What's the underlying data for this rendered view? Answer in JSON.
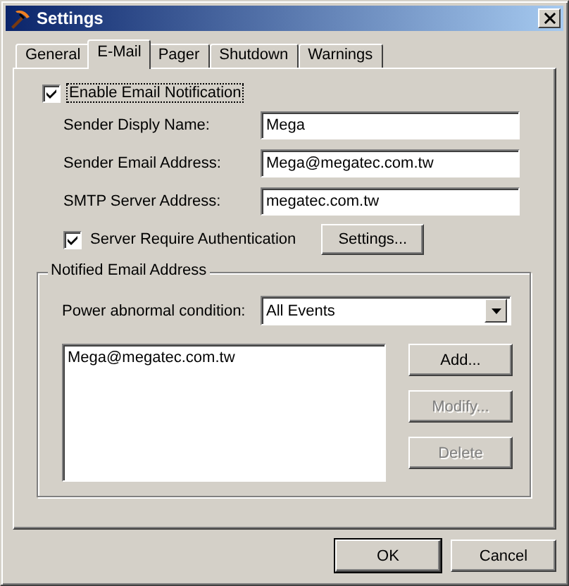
{
  "window": {
    "title": "Settings"
  },
  "tabs": [
    {
      "label": "General",
      "selected": false
    },
    {
      "label": "E-Mail",
      "selected": true
    },
    {
      "label": "Pager",
      "selected": false
    },
    {
      "label": "Shutdown",
      "selected": false
    },
    {
      "label": "Warnings",
      "selected": false
    }
  ],
  "enable_notification": {
    "label": "Enable Email Notification",
    "checked": true,
    "focused": true
  },
  "fields": [
    {
      "label": "Sender Disply Name:",
      "value": "Mega"
    },
    {
      "label": "Sender Email Address:",
      "value": "Mega@megatec.com.tw"
    },
    {
      "label": "SMTP Server Address:",
      "value": "megatec.com.tw"
    }
  ],
  "authentication": {
    "label": "Server Require Authentication",
    "checked": true
  },
  "settings_button": {
    "label": "Settings..."
  },
  "notified_group": {
    "title": "Notified Email Address",
    "condition": {
      "label": "Power abnormal condition:",
      "value": "All Events"
    },
    "addresses": [
      {
        "text": "Mega@megatec.com.tw",
        "selected": false
      }
    ],
    "buttons": [
      {
        "label": "Add...",
        "disabled": false
      },
      {
        "label": "Modify...",
        "disabled": true
      },
      {
        "label": "Delete",
        "disabled": true
      }
    ]
  },
  "buttons": [
    {
      "label": "OK",
      "default": true
    },
    {
      "label": "Cancel",
      "default": false
    }
  ]
}
